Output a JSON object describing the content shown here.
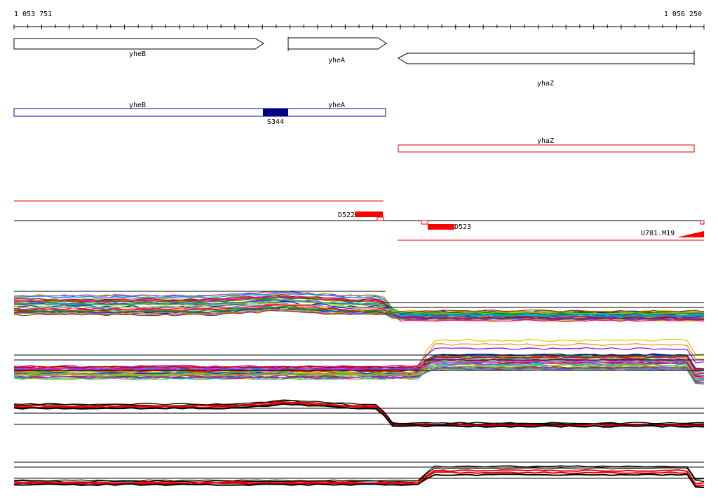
{
  "coordinates": {
    "start": "1 053 751",
    "end": "1 056 250"
  },
  "genes": [
    {
      "name": "yheB",
      "strand": "+"
    },
    {
      "name": "yheA",
      "strand": "+"
    },
    {
      "name": "yhaZ",
      "strand": "-"
    }
  ],
  "transcripts": [
    {
      "name": "yheB",
      "color": "#0000aa"
    },
    {
      "name": "yheA",
      "color": "#0000aa"
    },
    {
      "name": "yhaZ",
      "color": "#dd0000"
    }
  ],
  "segments": [
    {
      "name": "S344",
      "color": "#000080"
    },
    {
      "name": "D522",
      "color": "#ff0000"
    },
    {
      "name": "D523",
      "color": "#ff0000"
    },
    {
      "name": "U781.M19",
      "color": "#ff0000"
    }
  ],
  "expression_panels": [
    {
      "type": "multi-colour profiles",
      "step": "down"
    },
    {
      "type": "multi-colour profiles",
      "step": "up"
    },
    {
      "type": "red/black profiles",
      "step": "down"
    },
    {
      "type": "red/black profiles",
      "step": "up"
    }
  ]
}
